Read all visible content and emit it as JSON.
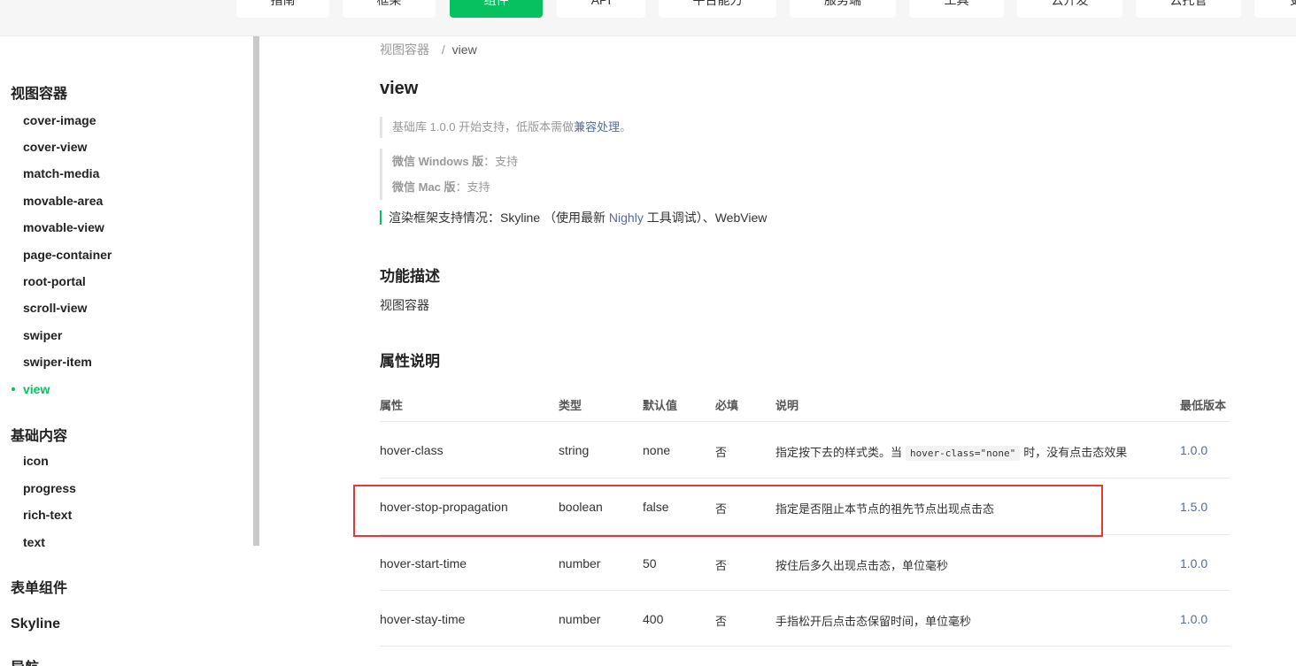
{
  "topnav": {
    "tabs": [
      {
        "label": "指南",
        "active": false
      },
      {
        "label": "框架",
        "active": false
      },
      {
        "label": "组件",
        "active": true
      },
      {
        "label": "API",
        "active": false
      },
      {
        "label": "平台能力",
        "active": false
      },
      {
        "label": "服务端",
        "active": false
      },
      {
        "label": "工具",
        "active": false
      },
      {
        "label": "云开发",
        "active": false
      },
      {
        "label": "云托管",
        "active": false
      },
      {
        "label": "更",
        "active": false
      }
    ]
  },
  "sidebar": {
    "groups": [
      {
        "label": "视图容器",
        "items": [
          "cover-image",
          "cover-view",
          "match-media",
          "movable-area",
          "movable-view",
          "page-container",
          "root-portal",
          "scroll-view",
          "swiper",
          "swiper-item",
          "view"
        ]
      },
      {
        "label": "基础内容",
        "items": [
          "icon",
          "progress",
          "rich-text",
          "text"
        ]
      },
      {
        "label": "表单组件",
        "items": []
      },
      {
        "label": "Skyline",
        "items": []
      },
      {
        "label": "导航",
        "items": []
      }
    ],
    "active_item": "view"
  },
  "breadcrumb": {
    "parent": "视图容器",
    "separator": "/",
    "current": "view"
  },
  "page_title": "view",
  "notes": {
    "support_prefix": "基础库 1.0.0 开始支持，低版本需做",
    "support_link": "兼容处理",
    "support_suffix": "。",
    "windows_label": "微信 Windows 版",
    "windows_value": "：支持",
    "mac_label": "微信 Mac 版",
    "mac_value": "：支持"
  },
  "render": {
    "prefix": "渲染框架支持情况：Skyline （使用最新 ",
    "nighly": "Nighly",
    "suffix": " 工具调试）、WebView"
  },
  "function_section": {
    "title": "功能描述",
    "text": "视图容器"
  },
  "props_section": {
    "title": "属性说明"
  },
  "table": {
    "headers": [
      "属性",
      "类型",
      "默认值",
      "必填",
      "说明",
      "最低版本"
    ],
    "rows": [
      {
        "name": "hover-class",
        "type": "string",
        "default": "none",
        "required": "否",
        "desc_prefix": "指定按下去的样式类。当",
        "desc_code": "hover-class=\"none\"",
        "desc_suffix": "时，没有点击态效果",
        "version": "1.0.0"
      },
      {
        "name": "hover-stop-propagation",
        "type": "boolean",
        "default": "false",
        "required": "否",
        "desc_prefix": "指定是否阻止本节点的祖先节点出现点击态",
        "desc_code": "",
        "desc_suffix": "",
        "version": "1.5.0"
      },
      {
        "name": "hover-start-time",
        "type": "number",
        "default": "50",
        "required": "否",
        "desc_prefix": "按住后多久出现点击态，单位毫秒",
        "desc_code": "",
        "desc_suffix": "",
        "version": "1.0.0"
      },
      {
        "name": "hover-stay-time",
        "type": "number",
        "default": "400",
        "required": "否",
        "desc_prefix": "手指松开后点击态保留时间，单位毫秒",
        "desc_code": "",
        "desc_suffix": "",
        "version": "1.0.0"
      }
    ]
  },
  "colors": {
    "accent": "#07c160",
    "link": "#576b95",
    "highlight": "#e53935"
  }
}
